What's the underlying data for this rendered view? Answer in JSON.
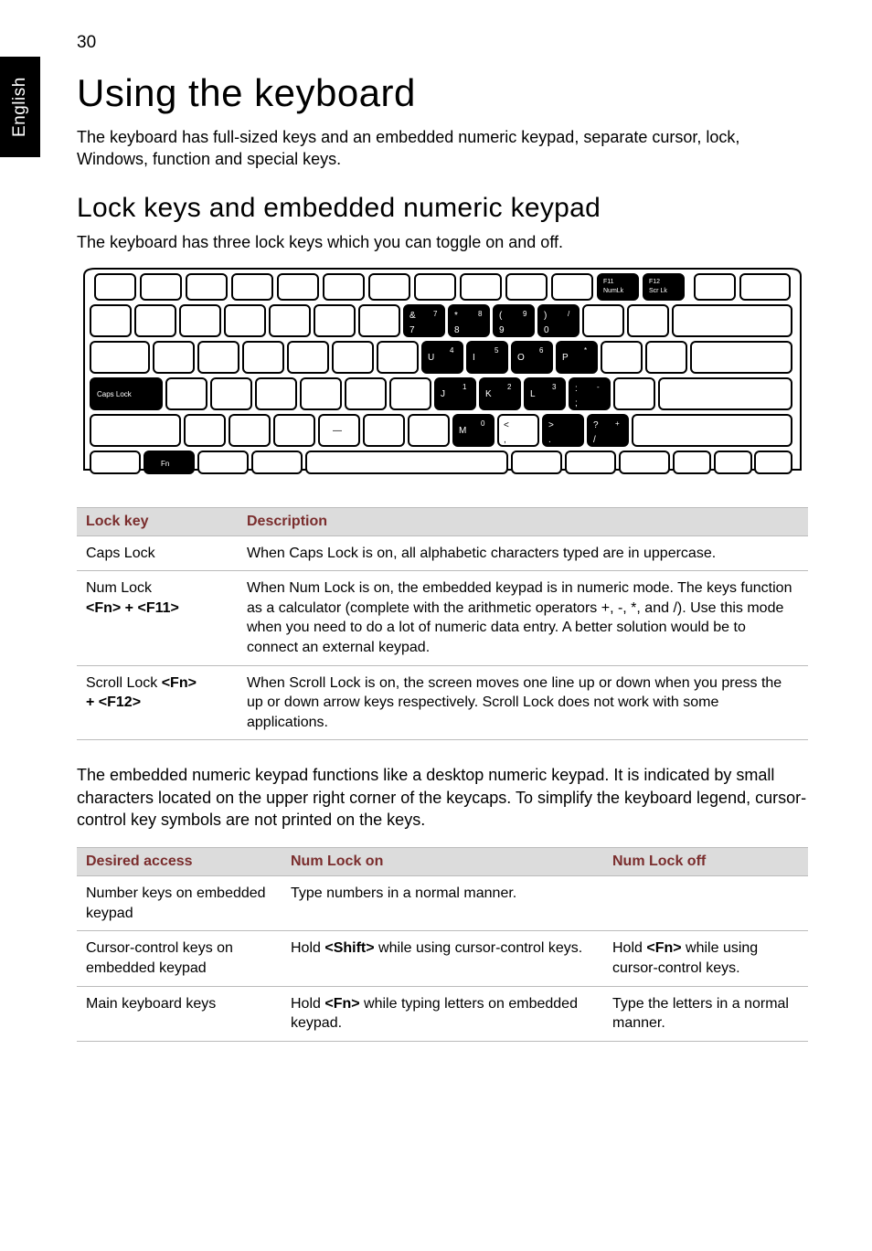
{
  "side_tab": "English",
  "page_number": "30",
  "h1": "Using the keyboard",
  "intro": "The keyboard has full-sized keys and an embedded numeric keypad, separate cursor, lock, Windows, function and special keys.",
  "h2": "Lock keys and embedded numeric keypad",
  "sub": "The keyboard has three lock keys which you can toggle on and off.",
  "lock_table": {
    "headers": [
      "Lock key",
      "Description"
    ],
    "rows": [
      {
        "key": "Caps Lock",
        "desc": "When Caps Lock is on, all alphabetic characters typed are in uppercase."
      },
      {
        "key": "Num Lock <Fn> + <F11>",
        "desc": "When Num Lock is on, the embedded keypad is in numeric mode. The keys function as a calculator (complete with the arithmetic operators +, -, *, and /). Use this mode when you need to do a lot of numeric data entry. A better solution would be to connect an external keypad."
      },
      {
        "key": "Scroll Lock <Fn> + <F12>",
        "desc": "When Scroll Lock is on, the screen moves one line up or down when you press the up or down arrow keys respectively. Scroll Lock does not work with some applications."
      }
    ]
  },
  "p2": "The embedded numeric keypad functions like a desktop numeric keypad. It is indicated by small characters located on the upper right corner of the keycaps. To simplify the keyboard legend, cursor-control key symbols are not printed on the keys.",
  "mode_table": {
    "headers": [
      "Desired access",
      "Num Lock on",
      "Num Lock off"
    ],
    "rows": [
      {
        "a": "Number keys on embedded keypad",
        "b": "Type numbers in a normal manner.",
        "c": ""
      },
      {
        "a": "Cursor-control keys on embedded keypad",
        "b": "Hold <Shift> while using cursor-control keys.",
        "c": "Hold <Fn> while using cursor-control keys."
      },
      {
        "a": "Main keyboard keys",
        "b": "Hold <Fn> while typing letters on embedded keypad.",
        "c": "Type the letters in a normal manner."
      }
    ]
  },
  "keyboard_svg": {
    "caps": "Caps Lock",
    "fn": "Fn",
    "f11a": "F11",
    "f11b": "NumLk",
    "f12a": "F12",
    "f12b": "Scr Lk",
    "k7a": "&",
    "k7b": "7",
    "k7c": "7",
    "k8a": "*",
    "k8b": "8",
    "k8c": "8",
    "k9a": "(",
    "k9b": "9",
    "k9c": "9",
    "k0a": ")",
    "k0b": "/",
    "k0c": "0",
    "ku": "U",
    "ku2": "4",
    "ki": "I",
    "ki2": "5",
    "ko": "O",
    "ko2": "6",
    "kp": "P",
    "kp2": "*",
    "kj": "J",
    "kj2": "1",
    "kk": "K",
    "kk2": "2",
    "kl": "L",
    "kl2": "3",
    "ksc": ";",
    "ksc2": ":",
    "ksc3": "-",
    "km": "M",
    "km2": "0",
    "kcm": ",",
    "kcm2": "<",
    "kdt": ".",
    "kdt2": ">",
    "ksl": "/",
    "ksl2": "?",
    "ksl3": "+",
    "dash": "—"
  }
}
